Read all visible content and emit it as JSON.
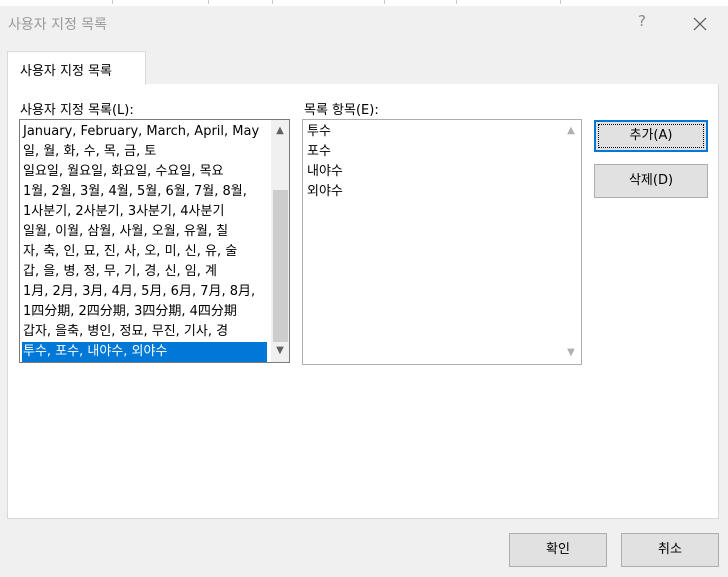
{
  "dialog": {
    "title": "사용자 지정 목록",
    "help_label": "?",
    "tab_label": "사용자 지정 목록"
  },
  "custom_lists": {
    "label": "사용자 지정 목록(L):",
    "items": [
      "January, February, March, April, May",
      "일, 월, 화, 수, 목, 금, 토",
      "일요일, 월요일, 화요일, 수요일, 목요",
      "1월, 2월, 3월, 4월, 5월, 6월, 7월, 8월,",
      "1사분기, 2사분기, 3사분기, 4사분기",
      "일월, 이월, 삼월, 사월, 오월, 유월, 칠",
      "자, 축, 인, 묘, 진, 사, 오, 미, 신, 유, 술",
      "갑, 을, 병, 정, 무, 기, 경, 신, 임, 계",
      "1月, 2月, 3月, 4月, 5月, 6月, 7月, 8月,",
      "1四分期, 2四分期, 3四分期, 4四分期",
      "갑자, 을축, 병인, 정묘, 무진, 기사, 경",
      "투수, 포수, 내야수, 외야수"
    ],
    "selected_index": 11
  },
  "list_entries": {
    "label": "목록 항목(E):",
    "lines": [
      "투수",
      "포수",
      "내야수",
      "외야수"
    ]
  },
  "buttons": {
    "add": "추가(A)",
    "delete": "삭제(D)",
    "ok": "확인",
    "cancel": "취소"
  },
  "colors": {
    "selection": "#0078d7",
    "default_button_border": "#0078d7"
  }
}
